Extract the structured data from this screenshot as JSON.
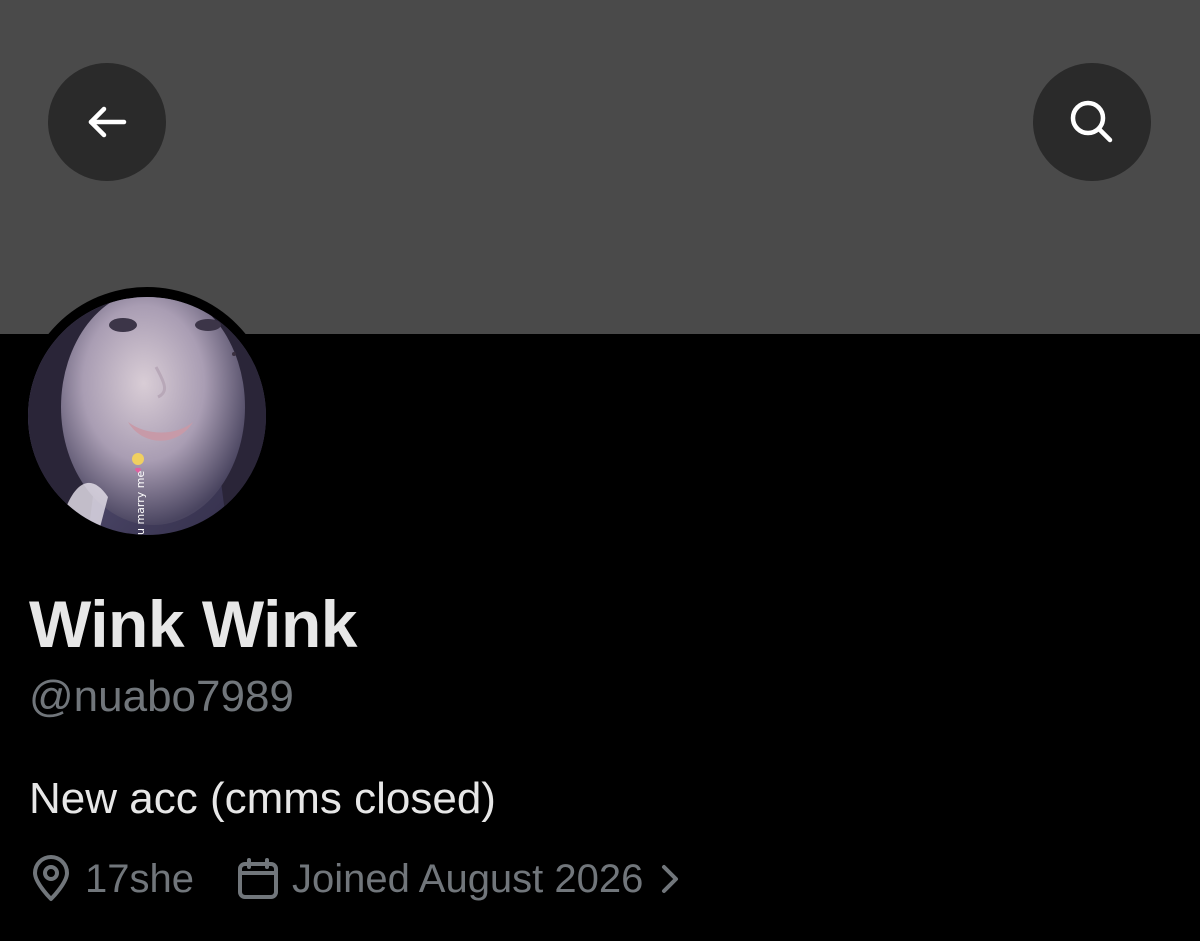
{
  "header": {
    "back_icon": "arrow-left-icon",
    "search_icon": "search-icon",
    "banner_color": "#4a4a4a"
  },
  "profile": {
    "avatar_caption": "u marry me",
    "display_name": "Wink Wink",
    "handle": "@nuabo7989",
    "bio": "New acc (cmms closed)",
    "location": "17she",
    "location_icon": "location-pin-icon",
    "joined": "Joined August 2026",
    "joined_icon": "calendar-icon",
    "chevron_icon": "chevron-right-icon"
  },
  "colors": {
    "background": "#000000",
    "primary_text": "#e7e7e7",
    "secondary_text": "#71767b",
    "button_bg": "#2a2a2a"
  }
}
